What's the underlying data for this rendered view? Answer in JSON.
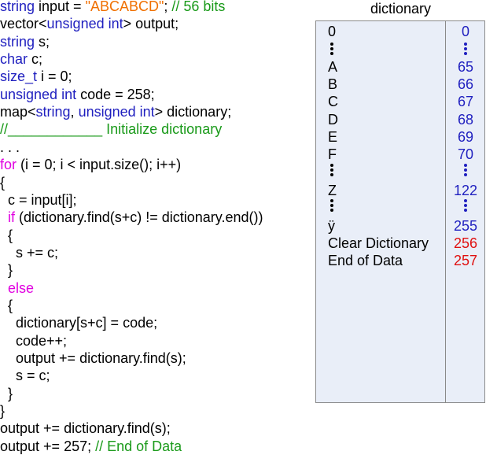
{
  "code_lines": [
    [
      {
        "t": "string",
        "c": "kw"
      },
      {
        "t": " input = "
      },
      {
        "t": "\"ABCABCD\"",
        "c": "str"
      },
      {
        "t": "; "
      },
      {
        "t": "// 56 bits",
        "c": "cmt"
      }
    ],
    [
      {
        "t": "vector<"
      },
      {
        "t": "unsigned int",
        "c": "kw"
      },
      {
        "t": "> output;"
      }
    ],
    [
      {
        "t": "string",
        "c": "kw"
      },
      {
        "t": " s;"
      }
    ],
    [
      {
        "t": "char",
        "c": "kw"
      },
      {
        "t": " c;"
      }
    ],
    [
      {
        "t": "size_t",
        "c": "kw"
      },
      {
        "t": " i = 0;"
      }
    ],
    [
      {
        "t": "unsigned int",
        "c": "kw"
      },
      {
        "t": " code = 258;"
      }
    ],
    [
      {
        "t": "map<"
      },
      {
        "t": "string",
        "c": "kw"
      },
      {
        "t": ", "
      },
      {
        "t": "unsigned int",
        "c": "kw"
      },
      {
        "t": "> dictionary;"
      }
    ],
    [
      {
        "t": "//____________ Initialize dictionary",
        "c": "cmt"
      }
    ],
    [
      {
        "t": ". . ."
      }
    ],
    [
      {
        "t": "for",
        "c": "ctl"
      },
      {
        "t": " (i = 0; i < input.size(); i++)"
      }
    ],
    [
      {
        "t": "{"
      }
    ],
    [
      {
        "t": "  c = input[i];"
      }
    ],
    [
      {
        "t": "  "
      },
      {
        "t": "if",
        "c": "ctl"
      },
      {
        "t": " (dictionary.find(s+c) != dictionary.end())"
      }
    ],
    [
      {
        "t": "  {"
      }
    ],
    [
      {
        "t": "    s += c;"
      }
    ],
    [
      {
        "t": "  }"
      }
    ],
    [
      {
        "t": "  "
      },
      {
        "t": "else",
        "c": "ctl"
      }
    ],
    [
      {
        "t": "  {"
      }
    ],
    [
      {
        "t": "    dictionary[s+c] = code;"
      }
    ],
    [
      {
        "t": "    code++;"
      }
    ],
    [
      {
        "t": "    output += dictionary.find(s);"
      }
    ],
    [
      {
        "t": "    s = c;"
      }
    ],
    [
      {
        "t": "  }"
      }
    ],
    [
      {
        "t": "}"
      }
    ],
    [
      {
        "t": "output += dictionary.find(s);"
      }
    ],
    [
      {
        "t": "output += 257; "
      },
      {
        "t": "// End of Data",
        "c": "cmt"
      }
    ]
  ],
  "dictionary": {
    "title": "dictionary",
    "rows": [
      {
        "key": "0",
        "value": "0"
      },
      {
        "key": "A",
        "value": "65"
      },
      {
        "key": "B",
        "value": "66"
      },
      {
        "key": "C",
        "value": "67"
      },
      {
        "key": "D",
        "value": "68"
      },
      {
        "key": "E",
        "value": "69"
      },
      {
        "key": "F",
        "value": "70"
      },
      {
        "key": "Z",
        "value": "122"
      },
      {
        "key": "ÿ",
        "value": "255"
      },
      {
        "key": "Clear Dictionary",
        "value": "256",
        "special": true
      },
      {
        "key": "End of Data",
        "value": "257",
        "special": true
      }
    ]
  }
}
